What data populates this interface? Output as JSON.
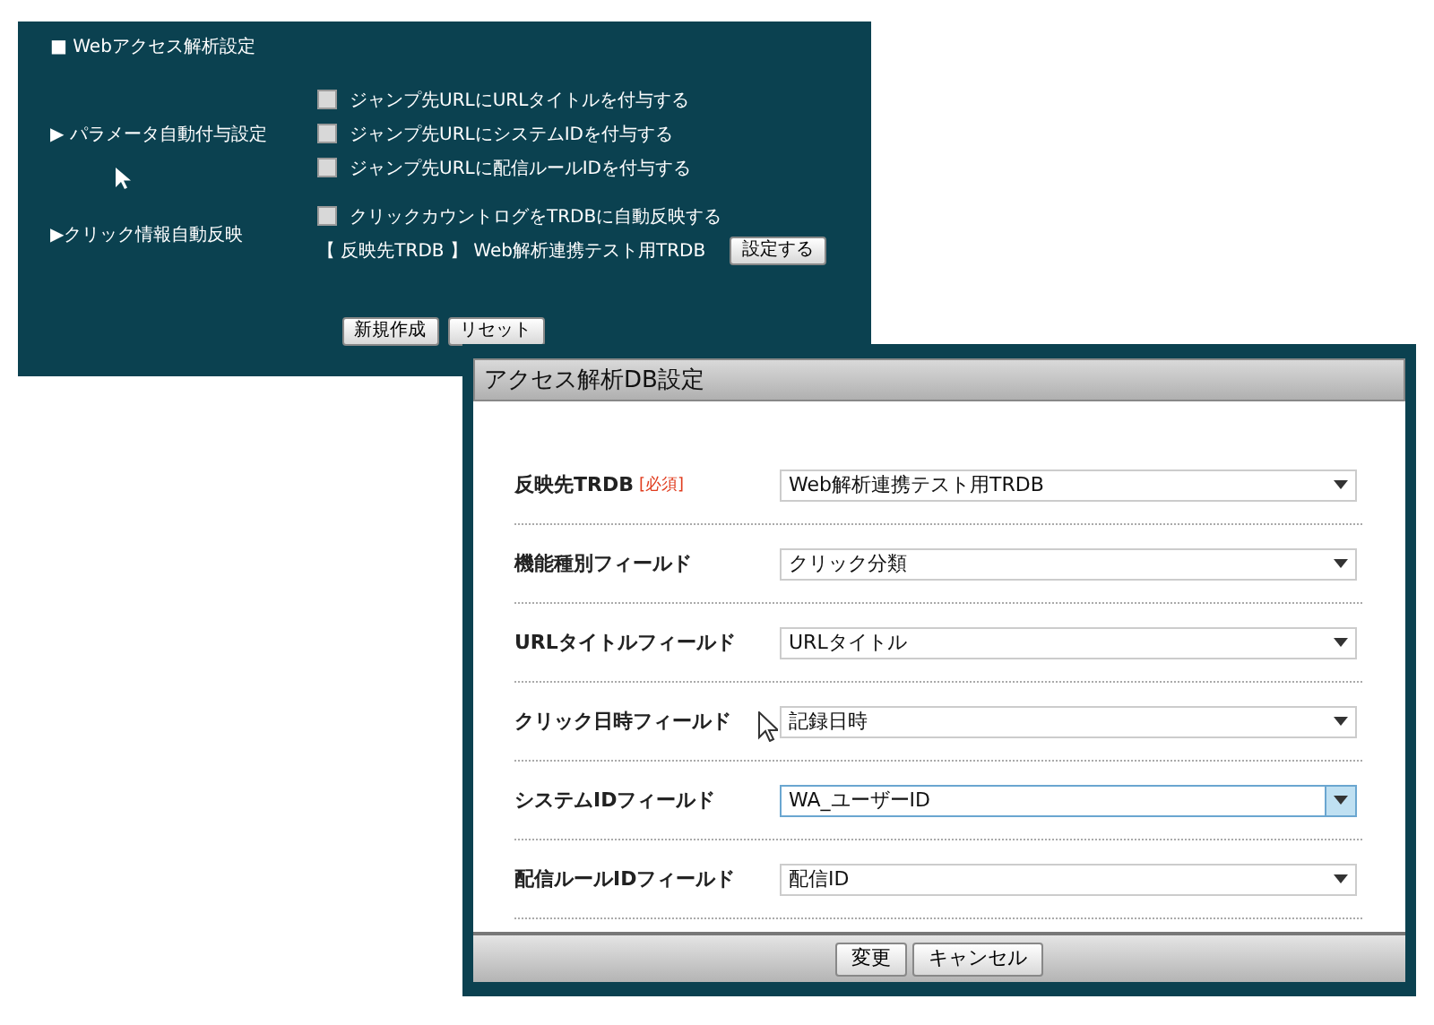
{
  "settings_panel": {
    "title": "■ Webアクセス解析設定",
    "sections": [
      {
        "label": "▶ パラメータ自動付与設定",
        "items": [
          {
            "kind": "checkbox",
            "label": "ジャンプ先URLにURLタイトルを付与する",
            "checked": false
          },
          {
            "kind": "checkbox",
            "label": "ジャンプ先URLにシステムIDを付与する",
            "checked": false
          },
          {
            "kind": "checkbox",
            "label": "ジャンプ先URLに配信ルールIDを付与する",
            "checked": false
          }
        ]
      },
      {
        "label": "▶クリック情報自動反映",
        "items": [
          {
            "kind": "checkbox",
            "label": "クリックカウントログをTRDBに自動反映する",
            "checked": false
          },
          {
            "kind": "setting",
            "label": "【 反映先TRDB 】 Web解析連携テスト用TRDB",
            "button": "設定する"
          }
        ]
      }
    ],
    "buttons": [
      "新規作成",
      "リセット"
    ]
  },
  "dialog": {
    "title": "アクセス解析DB設定",
    "fields": [
      {
        "label": "反映先TRDB",
        "required": "[必須]",
        "value": "Web解析連携テスト用TRDB",
        "focused": false
      },
      {
        "label": "機能種別フィールド",
        "value": "クリック分類",
        "focused": false
      },
      {
        "label": "URLタイトルフィールド",
        "value": "URLタイトル",
        "focused": false
      },
      {
        "label": "クリック日時フィールド",
        "value": "記録日時",
        "focused": false
      },
      {
        "label": "システムIDフィールド",
        "value": "WA_ユーザーID",
        "focused": true
      },
      {
        "label": "配信ルールIDフィールド",
        "value": "配信ID",
        "focused": false
      }
    ],
    "buttons": [
      "変更",
      "キャンセル"
    ]
  }
}
